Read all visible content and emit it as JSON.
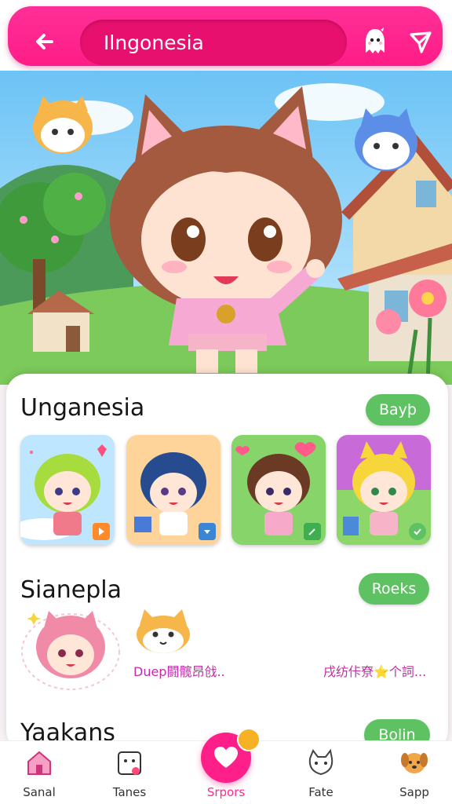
{
  "header": {
    "search_text": "Ilngonesia",
    "back_icon": "arrow-left-icon",
    "ghost_icon": "ghost-icon",
    "send_icon": "send-icon"
  },
  "sections": [
    {
      "title": "Unganesia",
      "button": "Bayþ"
    },
    {
      "title": "Sianepla",
      "button": "Roeks"
    },
    {
      "title": "Yaakans",
      "button": "Bolin"
    }
  ],
  "thumbs": [
    {
      "hair": "#a7dc3f",
      "bg": "#bfe6ff",
      "badge_color": "#ff8a2a",
      "badge_icon": "play-icon"
    },
    {
      "hair": "#274b8f",
      "bg": "#ffd49a",
      "badge_color": "#3a86d4",
      "badge_icon": "down-icon"
    },
    {
      "hair": "#6b3a24",
      "bg": "#86d46a",
      "badge_color": "#3fae4e",
      "badge_icon": "edit-icon"
    },
    {
      "hair": "#f6d63a",
      "bg": "#c86ad8",
      "badge_color": "#5ec262",
      "badge_icon": "check-icon"
    }
  ],
  "sianepla_texts": [
    "Duep闘髋昂戗..",
    "戌纺佧尞⭐个詞..."
  ],
  "bottom_nav": [
    {
      "label": "Sanal",
      "icon": "home-icon"
    },
    {
      "label": "Tanes",
      "icon": "card-icon"
    },
    {
      "label": "Srpors",
      "icon": "heart-icon"
    },
    {
      "label": "Fate",
      "icon": "cat-icon"
    },
    {
      "label": "Sapp",
      "icon": "dog-icon"
    }
  ],
  "colors": {
    "brand_pink": "#ff1f89",
    "accent_green": "#5ec262"
  }
}
